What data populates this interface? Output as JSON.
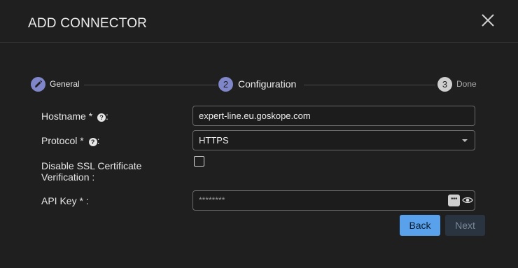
{
  "dialog": {
    "title": "ADD CONNECTOR"
  },
  "stepper": {
    "steps": [
      {
        "number": "1",
        "label": "General",
        "state": "completed",
        "icon": "pencil-icon"
      },
      {
        "number": "2",
        "label": "Configuration",
        "state": "active"
      },
      {
        "number": "3",
        "label": "Done",
        "state": "pending"
      }
    ]
  },
  "form": {
    "hostname_label": "Hostname * ",
    "hostname_label_suffix": ":",
    "hostname_value": "expert-line.eu.goskope.com",
    "protocol_label": "Protocol * ",
    "protocol_label_suffix": ":",
    "protocol_value": "HTTPS",
    "ssl_label_line1": "Disable SSL Certificate",
    "ssl_label_line2": "Verification  :",
    "ssl_checked": false,
    "apikey_label": "API Key * :",
    "apikey_value": "********",
    "help_glyph": "?"
  },
  "buttons": {
    "back": "Back",
    "next": "Next"
  },
  "colors": {
    "background": "#1f1f1f",
    "step_done": "#7f86c9",
    "step_pending": "#cfcfcf",
    "primary_button": "#5aa1ec",
    "disabled_button": "#2a3440"
  },
  "icons": {
    "close": "close-icon",
    "eye": "eye-icon",
    "dots": "more-dots-icon",
    "help": "question-circle-icon",
    "caret": "chevron-down-icon"
  }
}
